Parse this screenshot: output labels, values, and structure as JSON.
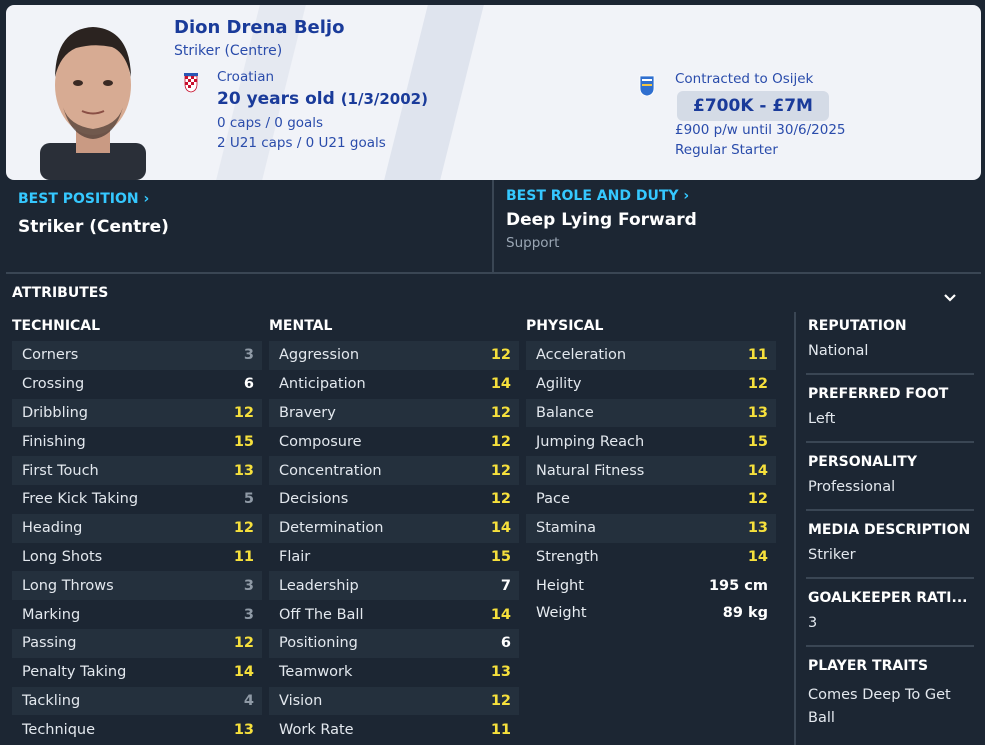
{
  "player": {
    "name": "Dion Drena Beljo",
    "position": "Striker (Centre)",
    "nationality": "Croatian",
    "age": "20 years old",
    "dob": "(1/3/2002)",
    "caps": "0 caps / 0 goals",
    "u21_caps": "2 U21 caps / 0 U21 goals"
  },
  "contract": {
    "club": "Contracted to Osijek",
    "value": "£700K - £7M",
    "wage": "£900 p/w until 30/6/2025",
    "status": "Regular Starter"
  },
  "best_position": {
    "label": "BEST POSITION",
    "value": "Striker (Centre)"
  },
  "best_role": {
    "label": "BEST ROLE AND DUTY",
    "role": "Deep Lying Forward",
    "duty": "Support"
  },
  "attributes": {
    "title": "ATTRIBUTES",
    "technical": {
      "title": "TECHNICAL",
      "items": [
        {
          "name": "Corners",
          "value": "3"
        },
        {
          "name": "Crossing",
          "value": "6"
        },
        {
          "name": "Dribbling",
          "value": "12"
        },
        {
          "name": "Finishing",
          "value": "15"
        },
        {
          "name": "First Touch",
          "value": "13"
        },
        {
          "name": "Free Kick Taking",
          "value": "5"
        },
        {
          "name": "Heading",
          "value": "12"
        },
        {
          "name": "Long Shots",
          "value": "11"
        },
        {
          "name": "Long Throws",
          "value": "3"
        },
        {
          "name": "Marking",
          "value": "3"
        },
        {
          "name": "Passing",
          "value": "12"
        },
        {
          "name": "Penalty Taking",
          "value": "14"
        },
        {
          "name": "Tackling",
          "value": "4"
        },
        {
          "name": "Technique",
          "value": "13"
        }
      ]
    },
    "mental": {
      "title": "MENTAL",
      "items": [
        {
          "name": "Aggression",
          "value": "12"
        },
        {
          "name": "Anticipation",
          "value": "14"
        },
        {
          "name": "Bravery",
          "value": "12"
        },
        {
          "name": "Composure",
          "value": "12"
        },
        {
          "name": "Concentration",
          "value": "12"
        },
        {
          "name": "Decisions",
          "value": "12"
        },
        {
          "name": "Determination",
          "value": "14"
        },
        {
          "name": "Flair",
          "value": "15"
        },
        {
          "name": "Leadership",
          "value": "7"
        },
        {
          "name": "Off The Ball",
          "value": "14"
        },
        {
          "name": "Positioning",
          "value": "6"
        },
        {
          "name": "Teamwork",
          "value": "13"
        },
        {
          "name": "Vision",
          "value": "12"
        },
        {
          "name": "Work Rate",
          "value": "11"
        }
      ]
    },
    "physical": {
      "title": "PHYSICAL",
      "items": [
        {
          "name": "Acceleration",
          "value": "11"
        },
        {
          "name": "Agility",
          "value": "12"
        },
        {
          "name": "Balance",
          "value": "13"
        },
        {
          "name": "Jumping Reach",
          "value": "15"
        },
        {
          "name": "Natural Fitness",
          "value": "14"
        },
        {
          "name": "Pace",
          "value": "12"
        },
        {
          "name": "Stamina",
          "value": "13"
        },
        {
          "name": "Strength",
          "value": "14"
        }
      ],
      "height_label": "Height",
      "height": "195 cm",
      "weight_label": "Weight",
      "weight": "89 kg"
    }
  },
  "info": {
    "reputation_label": "REPUTATION",
    "reputation": "National",
    "foot_label": "PREFERRED FOOT",
    "foot": "Left",
    "personality_label": "PERSONALITY",
    "personality": "Professional",
    "media_label": "MEDIA DESCRIPTION",
    "media": "Striker",
    "gk_label": "GOALKEEPER RATI...",
    "gk": "3",
    "traits_label": "PLAYER TRAITS",
    "traits_line1": "Comes Deep To Get",
    "traits_line2": "Ball"
  },
  "colors": {
    "high": "#f6e03c",
    "mid": "#ffffff",
    "low": "#8f9aa6",
    "accent": "#35c8ff"
  },
  "icons": {
    "chevron": "chevron-down-icon",
    "flag": "croatia-flag-icon",
    "club": "osijek-badge-icon"
  }
}
